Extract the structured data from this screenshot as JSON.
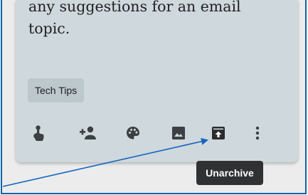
{
  "note": {
    "text_line1": "any suggestions for an email",
    "text_line2": "topic.",
    "label": "Tech Tips"
  },
  "toolbar": {
    "items": [
      {
        "name": "remind-me",
        "icon": "hand-pointer-bell-icon"
      },
      {
        "name": "collaborator",
        "icon": "person-add-icon"
      },
      {
        "name": "background-options",
        "icon": "palette-icon"
      },
      {
        "name": "add-image",
        "icon": "image-icon"
      },
      {
        "name": "unarchive",
        "icon": "unarchive-icon"
      },
      {
        "name": "more",
        "icon": "more-vert-icon"
      }
    ]
  },
  "tooltip": {
    "text": "Unarchive"
  },
  "colors": {
    "card_background": "#cfd8dc",
    "label_background": "#bdc8cd",
    "icon": "#3c4043",
    "tooltip_background": "#2f3133",
    "annotation_arrow": "#1565c0",
    "frame_border": "#0a63a8"
  }
}
